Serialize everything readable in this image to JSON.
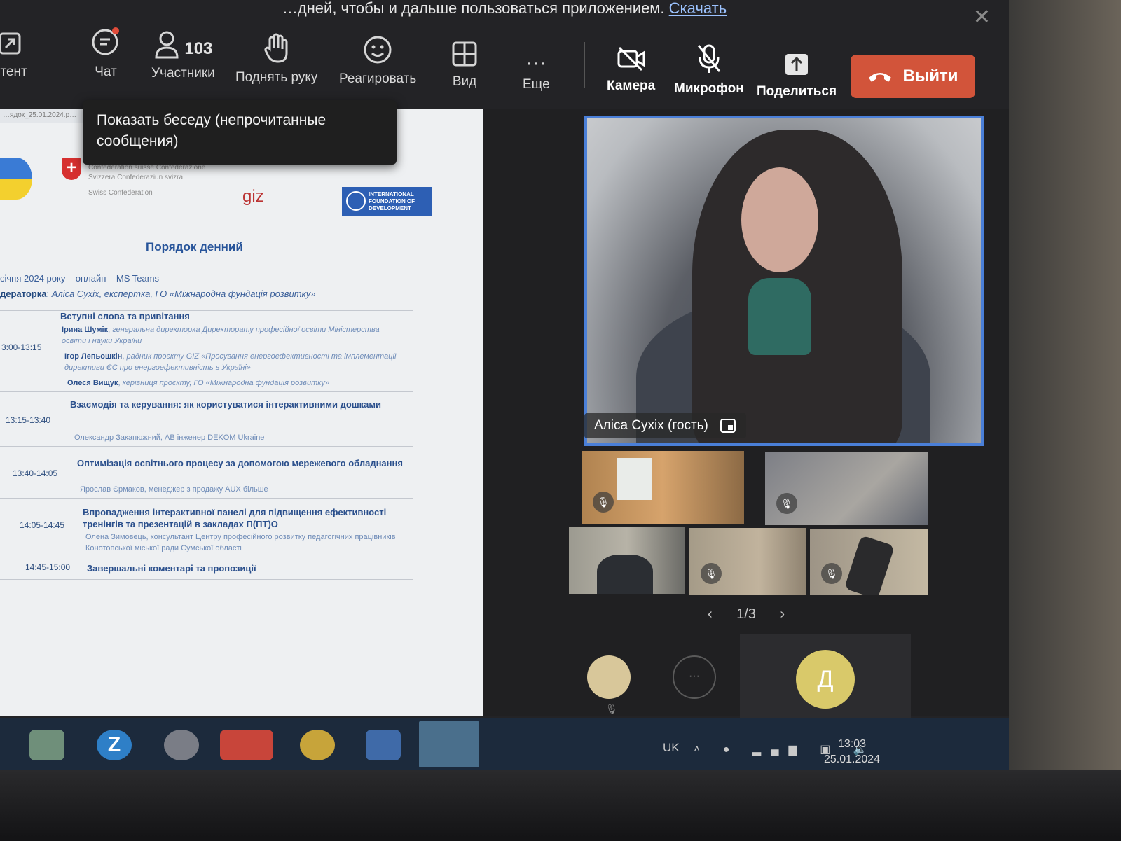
{
  "banner": {
    "text": "…дней, чтобы и дальше пользоваться приложением.",
    "link": "Скачать",
    "close_glyph": "✕"
  },
  "toolbar": {
    "content_label": "нтент",
    "chat_label": "Чат",
    "participants_count": "103",
    "participants_label": "Участники",
    "raise_hand_label": "Поднять руку",
    "react_label": "Реагировать",
    "view_label": "Вид",
    "more_label": "Еще",
    "camera_label": "Камера",
    "mic_label": "Микрофон",
    "share_label": "Поделиться",
    "leave_label": "Выйти",
    "leave_color": "#d2543a"
  },
  "tooltip": {
    "text": "Показать беседу (непрочитанные сообщения)"
  },
  "document": {
    "tab_name": "…ядок_25.01.2024.p…",
    "swiss_text": "Schweizerische Eidgenossenschaft Confédération suisse Confederazione Svizzera Confederaziun svizra",
    "swiss_sub": "Swiss Confederation",
    "giz_label": "giz",
    "ifd_text": "INTERNATIONAL FOUNDATION OF DEVELOPMENT",
    "title": "Порядок денний",
    "date_line": "січня 2024 року – онлайн – MS Teams",
    "moderator_label": "дераторка",
    "moderator_text": "Аліса Сухіх, експертка, ГО «Міжнародна фундація розвитку»",
    "rows": [
      {
        "time": "3:00-13:15",
        "title": "Вступні слова та привітання",
        "speakers": [
          {
            "name": "Ірина Шумік",
            "role": "генеральна директорка Директорату професійної освіти Міністерства освіти і науки України"
          },
          {
            "name": "Ігор Лепьошкін",
            "role": "радник проєкту GIZ «Просування енергоефективності та імплементації директиви ЄС про енергоефективність в Україні»"
          },
          {
            "name": "Олеся Вищук",
            "role": "керівниця проєкту, ГО «Міжнародна фундація розвитку»"
          }
        ]
      },
      {
        "time": "13:15-13:40",
        "title": "Взаємодія та керування: як користуватися інтерактивними дошками",
        "speaker": "Олександр Закапюжний, АВ інженер DEKOM Ukraine"
      },
      {
        "time": "13:40-14:05",
        "title": "Оптимізація освітнього процесу за допомогою мережевого обладнання",
        "speaker": "Ярослав Єрмаков, менеджер з продажу AUX більше"
      },
      {
        "time": "14:05-14:45",
        "title": "Впровадження інтерактивної панелі для підвищення ефективності тренінгів та презентацій в закладах П(ПТ)О",
        "speaker": "Олена Зимовець, консультант Центру професійного розвитку педагогічних працівників Конотопської міської ради Сумської області"
      },
      {
        "time": "14:45-15:00",
        "title": "Завершальні коментарі та пропозиції"
      }
    ]
  },
  "meeting": {
    "main_speaker_name": "Аліса Сухіх (гость)",
    "pager": "1/3",
    "self_initial": "Д",
    "more_glyph": "···",
    "highlight_color": "#4a7fd8"
  },
  "taskbar": {
    "lang": "UK",
    "time": "13:03",
    "date": "25.01.2024"
  }
}
